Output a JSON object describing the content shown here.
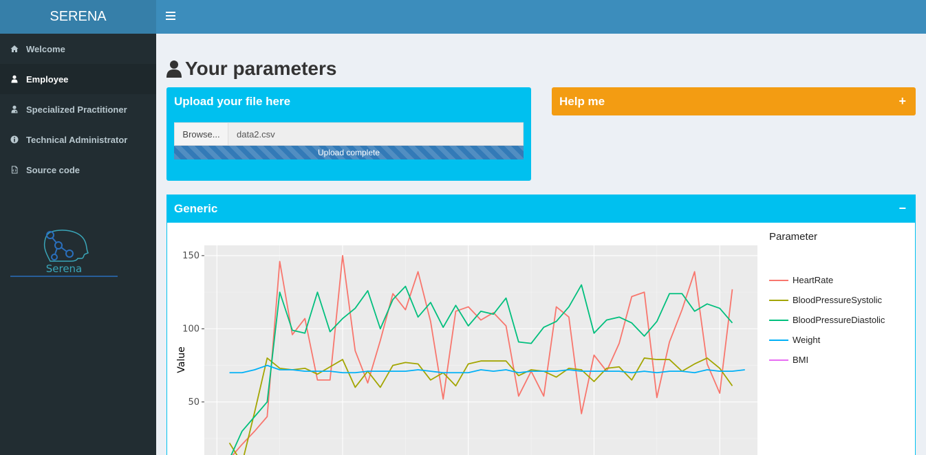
{
  "app": {
    "brand": "SERENA",
    "logo_text": "Serena"
  },
  "sidebar": {
    "items": [
      {
        "label": "Welcome",
        "icon": "home-icon",
        "active": false
      },
      {
        "label": "Employee",
        "icon": "user-icon",
        "active": true
      },
      {
        "label": "Specialized Practitioner",
        "icon": "user-md-icon",
        "active": false
      },
      {
        "label": "Technical Administrator",
        "icon": "info-circle-icon",
        "active": false
      },
      {
        "label": "Source code",
        "icon": "file-code-icon",
        "active": false
      }
    ]
  },
  "header": {
    "toggle_icon": "hamburger-icon"
  },
  "main": {
    "title": "Your parameters",
    "upload_box": {
      "title": "Upload your file here",
      "browse_label": "Browse...",
      "file_name": "data2.csv",
      "progress_label": "Upload complete",
      "progress_percent": 100
    },
    "help_box": {
      "title": "Help me",
      "tool": "+"
    },
    "generic_box": {
      "title": "Generic",
      "tool": "−"
    }
  },
  "colors": {
    "HeartRate": "#f8766d",
    "BloodPressureSystolic": "#a3a500",
    "BloodPressureDiastolic": "#00bf7d",
    "Weight": "#00b0f6",
    "BMI": "#e76bf3"
  },
  "chart_data": {
    "type": "line",
    "ylabel": "Value",
    "legend_title": "Parameter",
    "yticks": [
      50,
      100,
      150
    ],
    "xlim": [
      -1,
      43
    ],
    "ylim": [
      10,
      157
    ],
    "x": [
      1,
      2,
      3,
      4,
      5,
      6,
      7,
      8,
      9,
      10,
      11,
      12,
      13,
      14,
      15,
      16,
      17,
      18,
      19,
      20,
      21,
      22,
      23,
      24,
      25,
      26,
      27,
      28,
      29,
      30,
      31,
      32,
      33,
      34,
      35,
      36,
      37,
      38,
      39,
      40,
      41,
      42
    ],
    "series": [
      {
        "name": "HeartRate",
        "values": [
          11,
          21,
          30,
          40,
          146,
          96,
          107,
          65,
          65,
          150,
          85,
          63,
          92,
          124,
          113,
          139,
          105,
          52,
          112,
          115,
          106,
          111,
          102,
          54,
          71,
          54,
          115,
          108,
          42,
          82,
          71,
          90,
          122,
          125,
          53,
          91,
          113,
          139,
          76,
          56,
          127
        ]
      },
      {
        "name": "BloodPressureSystolic",
        "values": [
          22,
          8,
          43,
          80,
          73,
          72,
          73,
          69,
          74,
          79,
          60,
          71,
          60,
          75,
          77,
          76,
          65,
          70,
          61,
          76,
          78,
          78,
          78,
          68,
          72,
          71,
          67,
          73,
          72,
          64,
          73,
          74,
          65,
          80,
          79,
          79,
          71,
          76,
          80,
          73,
          61
        ]
      },
      {
        "name": "BloodPressureDiastolic",
        "values": [
          11,
          30,
          40,
          50,
          125,
          99,
          97,
          125,
          98,
          107,
          114,
          126,
          100,
          120,
          129,
          108,
          118,
          101,
          116,
          102,
          112,
          110,
          121,
          91,
          90,
          101,
          105,
          115,
          130,
          97,
          106,
          108,
          104,
          95,
          105,
          124,
          124,
          112,
          117,
          114,
          104
        ]
      },
      {
        "name": "Weight",
        "values": [
          70,
          70,
          72,
          75,
          72,
          72,
          71,
          71,
          71,
          70,
          70,
          71,
          71,
          71,
          71,
          72,
          71,
          70,
          70,
          70,
          72,
          71,
          72,
          70,
          71,
          71,
          71,
          72,
          71,
          71,
          71,
          71,
          70,
          71,
          70,
          71,
          71,
          70,
          72,
          71,
          71,
          72
        ]
      },
      {
        "name": "BMI",
        "values": []
      }
    ]
  }
}
